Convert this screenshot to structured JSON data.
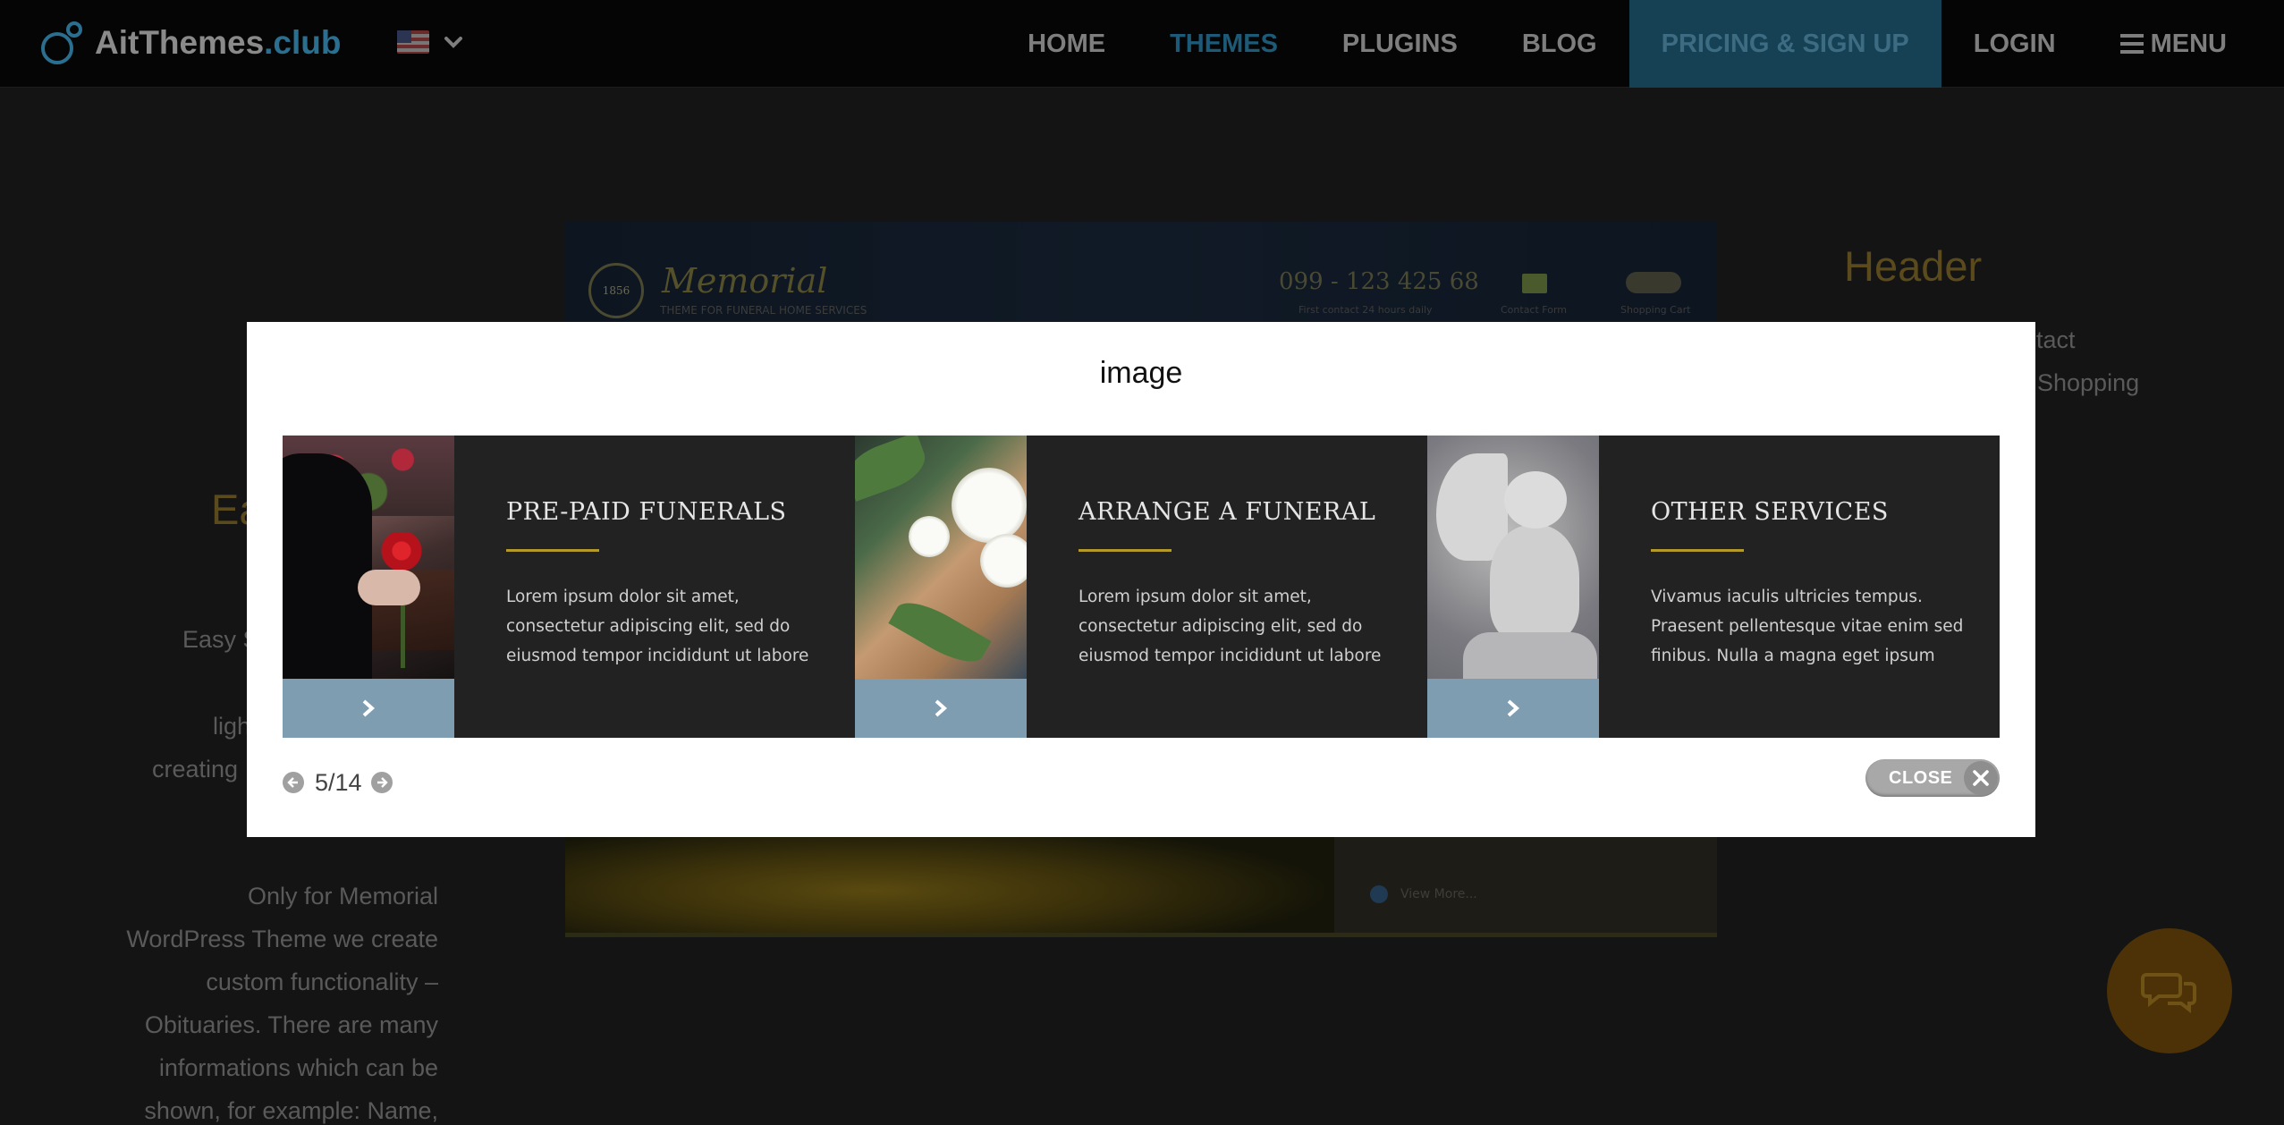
{
  "site": {
    "logo": {
      "name": "AitThemes",
      "tld": ".club"
    },
    "language": {
      "flag_icon": "us-flag-icon",
      "caret_icon": "chevron-down-icon"
    },
    "nav": [
      {
        "label": "HOME",
        "state": "default"
      },
      {
        "label": "THEMES",
        "state": "active"
      },
      {
        "label": "PLUGINS",
        "state": "default"
      },
      {
        "label": "BLOG",
        "state": "default"
      },
      {
        "label": "PRICING & SIGN UP",
        "state": "highlight"
      },
      {
        "label": "LOGIN",
        "state": "default"
      },
      {
        "label": "MENU",
        "state": "default",
        "icon": "hamburger-icon"
      }
    ]
  },
  "background": {
    "left_heading": "Ea",
    "left_sub": "Easy S",
    "left_line1": "ligh",
    "left_line2": "creating",
    "paragraph": "Only for Memorial WordPress Theme we create custom functionality – Obituaries. There are many informations which can be shown, for example: Name,",
    "sidebar_heading": "Header",
    "sidebar_contact": "ntact",
    "sidebar_shopping": "Shopping",
    "preview": {
      "emblem": "1856",
      "brand": "Memorial",
      "brand_sub": "THEME FOR FUNERAL HOME SERVICES",
      "phone": "099 - 123 425 68",
      "phone_sub": "First contact 24 hours daily",
      "contact_label": "Contact Form",
      "cart_label": "Shopping Cart",
      "view_more": "View More..."
    },
    "chat_icon": "chat-bubbles-icon"
  },
  "lightbox": {
    "title": "image",
    "cards": [
      {
        "title": "PRE-PAID FUNERALS",
        "text": "Lorem ipsum dolor sit amet, consectetur adipiscing elit, sed do eiusmod tempor incididunt ut labore",
        "photo": "rose-photo",
        "button_icon": "chevron-right-icon"
      },
      {
        "title": "ARRANGE A FUNERAL",
        "text": "Lorem ipsum dolor sit amet, consectetur adipiscing elit, sed do eiusmod tempor incididunt ut labore",
        "photo": "lily-photo",
        "button_icon": "chevron-right-icon"
      },
      {
        "title": "OTHER SERVICES",
        "text": "Vivamus iaculis ultricies tempus. Praesent pellentesque vitae enim sed finibus. Nulla a magna eget ipsum",
        "photo": "cherub-photo",
        "button_icon": "chevron-right-icon"
      }
    ],
    "counter": "5/14",
    "prev_icon": "arrow-left-circle-icon",
    "next_icon": "arrow-right-circle-icon",
    "close_label": "CLOSE",
    "close_icon": "close-x-icon"
  },
  "colors": {
    "overlay_page": "#141414",
    "topbar": "#050505",
    "brand_blue": "#2a6f8f",
    "card_bg": "#222222",
    "card_button": "#7e9db1",
    "gold_rule": "#b39a2a"
  }
}
